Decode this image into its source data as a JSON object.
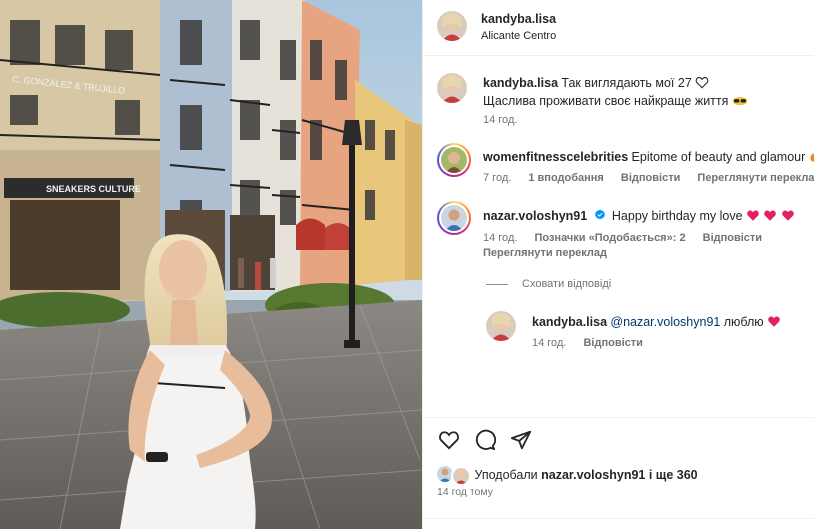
{
  "post": {
    "author": "kandyba.lisa",
    "location": "Alicante Centro"
  },
  "photo": {
    "signs": {
      "shop1": "C. GONZÁLEZ & TRUJILLO",
      "shop2": "SNEAKERS CULTURE"
    }
  },
  "caption": {
    "user": "kandyba.lisa",
    "line1": "Так виглядають мої 27",
    "line2": "Щаслива проживати своє найкраще життя",
    "time": "14 год."
  },
  "comments": [
    {
      "user": "womenfitnesscelebrities",
      "text": "Epitome of beauty and glamour",
      "time": "7 год.",
      "likes": "1 вподобання",
      "reply": "Відповісти",
      "translate": "Переглянути переклад"
    },
    {
      "user": "nazar.voloshyn91",
      "text": "Happy birthday my love",
      "time": "14 год.",
      "likes": "Позначки «Подобається»: 2",
      "reply": "Відповісти",
      "translate": "Переглянути переклад"
    }
  ],
  "hide_replies": "Сховати відповіді",
  "reply": {
    "user": "kandyba.lisa",
    "mention": "@nazar.voloshyn91",
    "text": "люблю",
    "time": "14 год.",
    "reply": "Відповісти"
  },
  "likes": {
    "prefix": "Уподобали",
    "user": "nazar.voloshyn91",
    "suffix": "і ще 360"
  },
  "timeago": "14 год тому",
  "colors": {
    "verified": "#0095f6",
    "heart": "#e0245e",
    "muted": "#737373"
  },
  "icons": [
    "heart-icon",
    "comment-icon",
    "share-icon",
    "verified-icon"
  ]
}
